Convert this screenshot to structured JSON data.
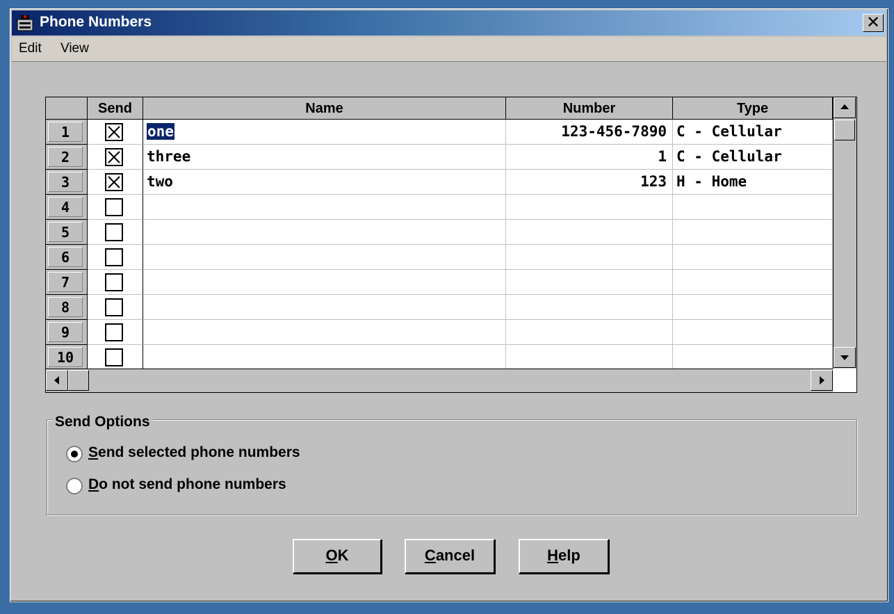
{
  "window": {
    "title": "Phone Numbers",
    "close_glyph": "✕"
  },
  "menu": {
    "items": [
      "Edit",
      "View"
    ]
  },
  "grid": {
    "columns": [
      "Send",
      "Name",
      "Number",
      "Type"
    ],
    "rows": [
      {
        "num": "1",
        "send": true,
        "name": "one",
        "number": "123-456-7890",
        "type": "C - Cellular"
      },
      {
        "num": "2",
        "send": true,
        "name": "three",
        "number": "1",
        "type": "C - Cellular"
      },
      {
        "num": "3",
        "send": true,
        "name": "two",
        "number": "123",
        "type": "H - Home"
      },
      {
        "num": "4",
        "send": false,
        "name": "",
        "number": "",
        "type": ""
      },
      {
        "num": "5",
        "send": false,
        "name": "",
        "number": "",
        "type": ""
      },
      {
        "num": "6",
        "send": false,
        "name": "",
        "number": "",
        "type": ""
      },
      {
        "num": "7",
        "send": false,
        "name": "",
        "number": "",
        "type": ""
      },
      {
        "num": "8",
        "send": false,
        "name": "",
        "number": "",
        "type": ""
      },
      {
        "num": "9",
        "send": false,
        "name": "",
        "number": "",
        "type": ""
      },
      {
        "num": "10",
        "send": false,
        "name": "",
        "number": "",
        "type": ""
      }
    ]
  },
  "send_options": {
    "title": "Send Options",
    "option1": {
      "accel": "S",
      "rest": "end selected phone numbers",
      "selected": true
    },
    "option2": {
      "accel": "D",
      "rest": "o not send phone numbers",
      "selected": false
    }
  },
  "buttons": {
    "ok": {
      "accel": "O",
      "rest": "K"
    },
    "cancel": {
      "accel": "C",
      "rest": "ancel"
    },
    "help": {
      "accel": "H",
      "rest": "elp"
    }
  },
  "colors": {
    "selection": "#0a246a",
    "face": "#c0c0c0",
    "desktop": "#3a6ea5"
  }
}
